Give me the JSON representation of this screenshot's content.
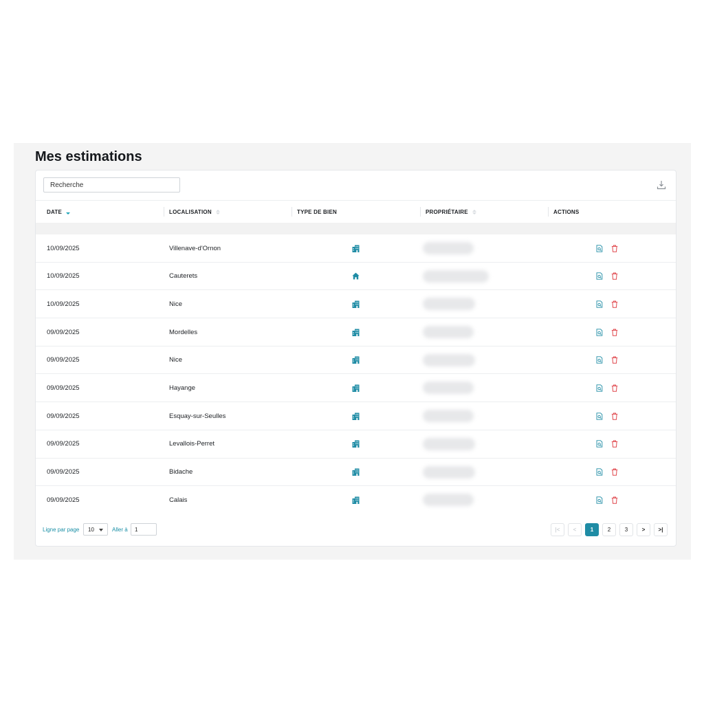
{
  "page_title": "Mes estimations",
  "search": {
    "placeholder": "Recherche"
  },
  "columns": {
    "date": "DATE",
    "location": "LOCALISATION",
    "type": "TYPE DE BIEN",
    "owner": "PROPRIÉTAIRE",
    "actions": "ACTIONS"
  },
  "rows": [
    {
      "date": "10/09/2025",
      "location": "Villenave-d'Ornon",
      "type_icon": "building-icon"
    },
    {
      "date": "10/09/2025",
      "location": "Cauterets",
      "type_icon": "house-icon"
    },
    {
      "date": "10/09/2025",
      "location": "Nice",
      "type_icon": "building-icon"
    },
    {
      "date": "09/09/2025",
      "location": "Mordelles",
      "type_icon": "building-icon"
    },
    {
      "date": "09/09/2025",
      "location": "Nice",
      "type_icon": "building-icon"
    },
    {
      "date": "09/09/2025",
      "location": "Hayange",
      "type_icon": "building-icon"
    },
    {
      "date": "09/09/2025",
      "location": "Esquay-sur-Seulles",
      "type_icon": "building-icon"
    },
    {
      "date": "09/09/2025",
      "location": "Levallois-Perret",
      "type_icon": "building-icon"
    },
    {
      "date": "09/09/2025",
      "location": "Bidache",
      "type_icon": "building-icon"
    },
    {
      "date": "09/09/2025",
      "location": "Calais",
      "type_icon": "building-icon"
    }
  ],
  "footer": {
    "rows_per_page_label": "Ligne par page",
    "rows_per_page_value": "10",
    "goto_label": "Aller à",
    "goto_value": "1"
  },
  "pagination": {
    "first": "|<",
    "prev": "<",
    "pages": [
      "1",
      "2",
      "3"
    ],
    "active_page": "1",
    "next": ">",
    "last": ">|"
  },
  "colors": {
    "accent": "#1f8ca5",
    "icon_teal": "#1f8ca5",
    "delete_red": "#e0474c"
  }
}
